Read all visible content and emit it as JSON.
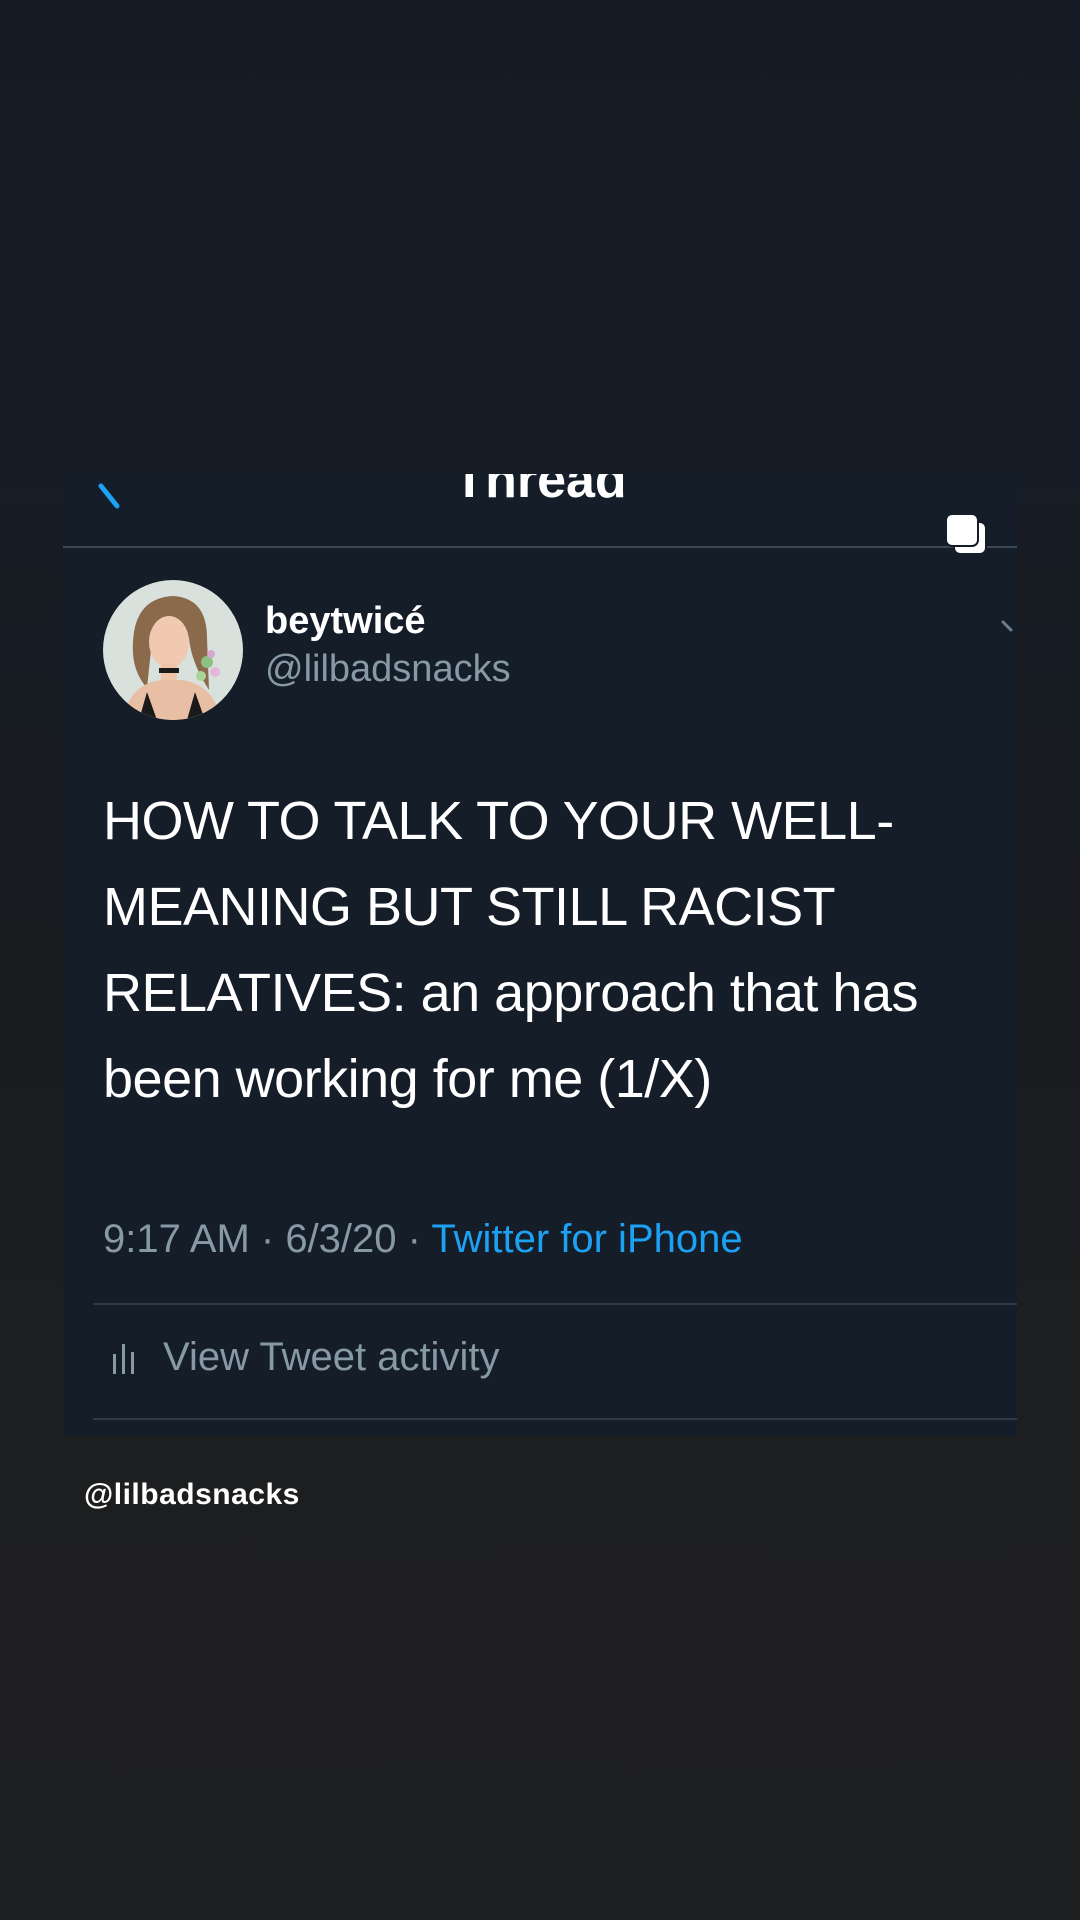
{
  "nav": {
    "title": "Thread",
    "back_icon": "back-arrow-icon"
  },
  "tweet": {
    "display_name": "beytwicé",
    "handle": "@lilbadsnacks",
    "text": "HOW TO TALK TO YOUR WELL-MEANING BUT STILL RACIST RELATIVES: an approach that has been working for me (1/X)",
    "time": "9:17 AM",
    "separator": " · ",
    "date": "6/3/20",
    "source": "Twitter for iPhone",
    "activity_label": "View Tweet activity",
    "activity_icon": "bar-chart-icon",
    "more_icon": "chevron-down-icon"
  },
  "overlay": {
    "copy_icon": "copy-icon",
    "watermark": "@lilbadsnacks"
  },
  "colors": {
    "background": "#1d1e20",
    "card": "#151d29",
    "accent": "#1da1f2",
    "secondary_text": "#8899a6"
  }
}
